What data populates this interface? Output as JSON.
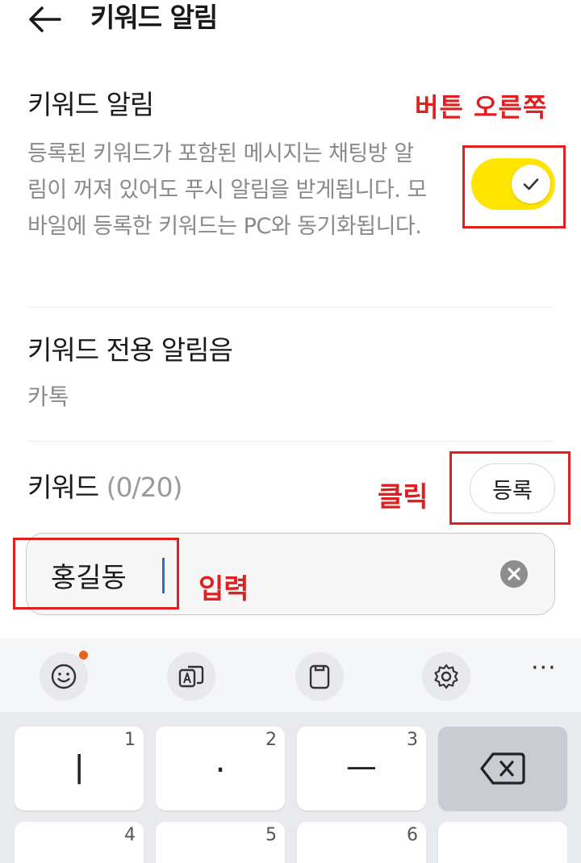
{
  "header": {
    "title": "키워드 알림"
  },
  "annotations": {
    "toggle_hint": "버튼 오른쪽",
    "click_hint": "클릭",
    "input_hint": "입력"
  },
  "keyword_alert": {
    "title": "키워드 알림",
    "description": "등록된 키워드가 포함된 메시지는 채팅방 알림이 꺼져 있어도 푸시 알림을 받게됩니다. 모바일에 등록한 키워드는 PC와 동기화됩니다.",
    "enabled": true,
    "toggle_color": "#fee500"
  },
  "sound": {
    "title": "키워드 전용 알림음",
    "value": "카톡"
  },
  "keywords": {
    "label": "키워드",
    "count": "(0/20)",
    "register_label": "등록",
    "input_value": "홍길동"
  },
  "keyboard": {
    "toolbar": [
      "emoji-icon",
      "translate-icon",
      "clipboard-icon",
      "settings-icon",
      "more-icon"
    ],
    "more_label": "···",
    "row1": [
      {
        "glyph": "ㅣ",
        "num": "1"
      },
      {
        "glyph": "·",
        "num": "2"
      },
      {
        "glyph": "ㅡ",
        "num": "3"
      }
    ],
    "row2_nums": [
      "4",
      "5",
      "6"
    ]
  }
}
